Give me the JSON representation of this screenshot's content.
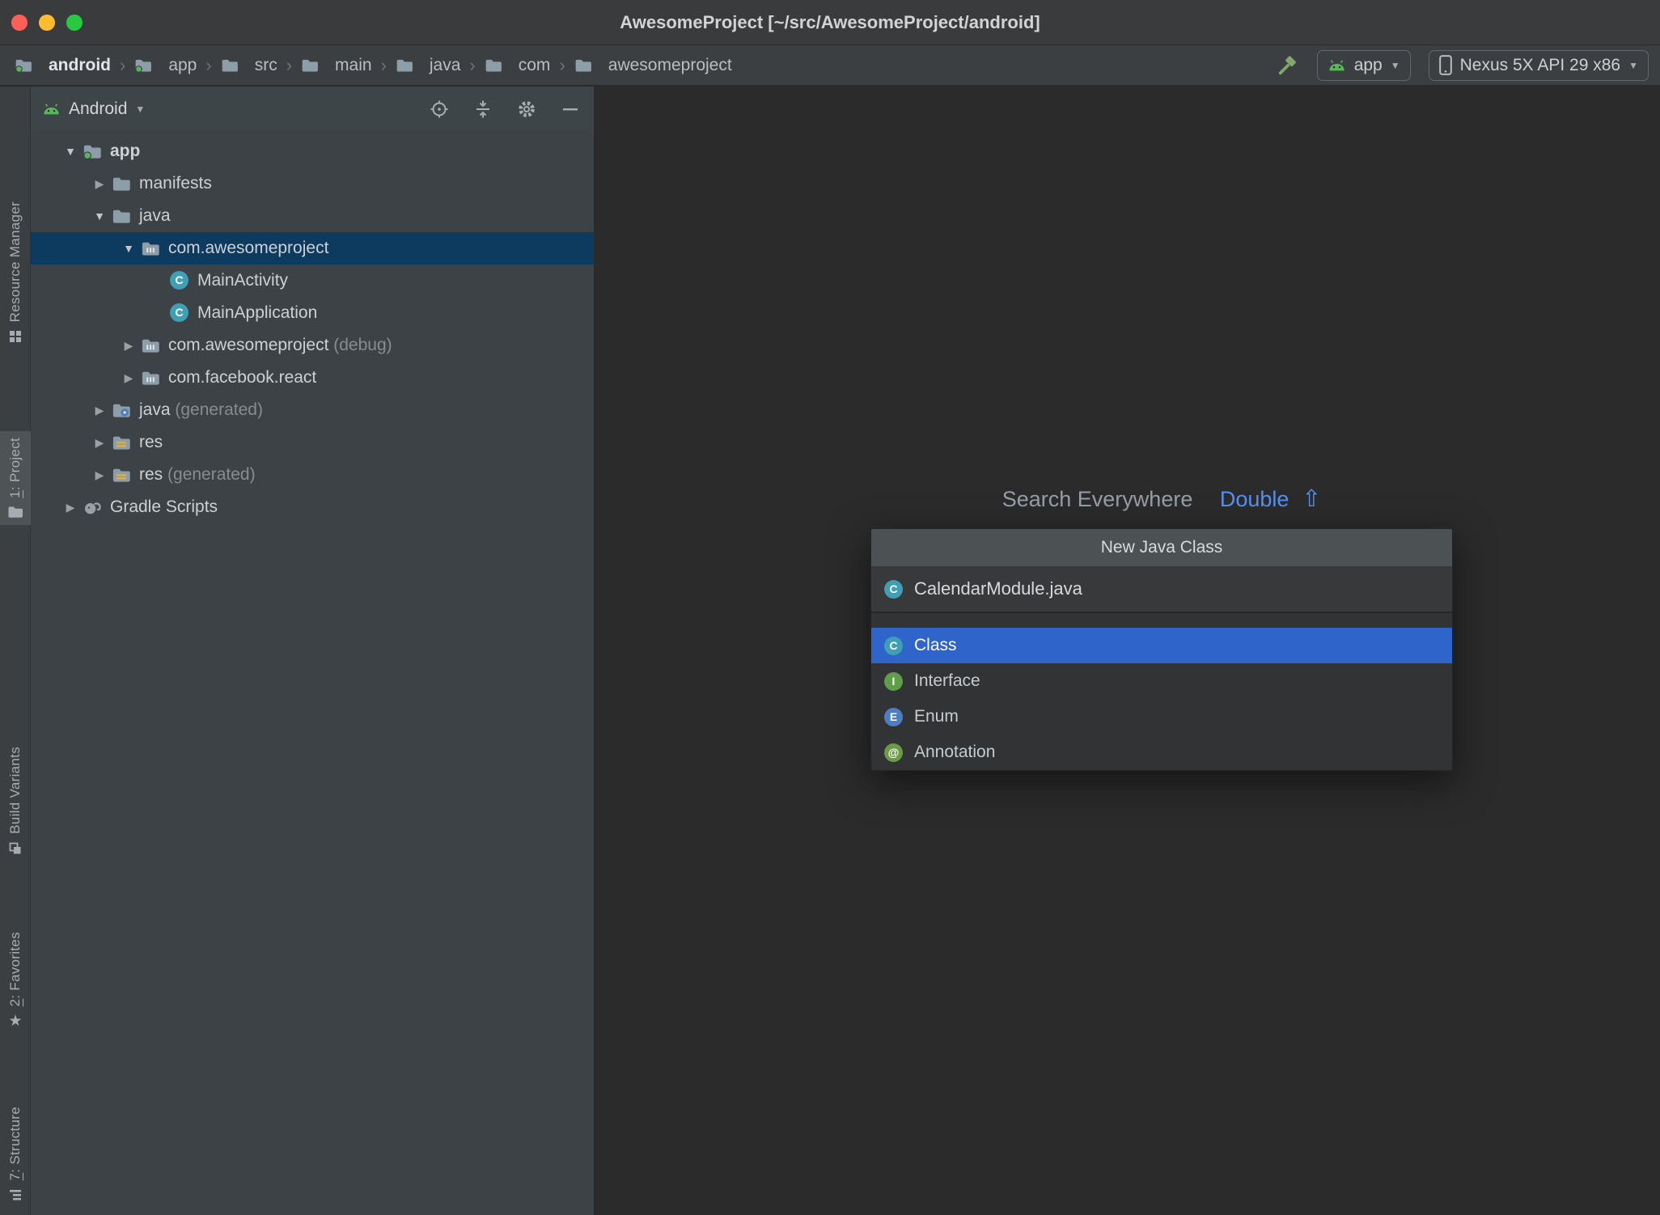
{
  "window": {
    "title": "AwesomeProject [~/src/AwesomeProject/android]"
  },
  "navbar": {
    "separator": "›",
    "breadcrumbs": [
      {
        "label": "android"
      },
      {
        "label": "app"
      },
      {
        "label": "src"
      },
      {
        "label": "main"
      },
      {
        "label": "java"
      },
      {
        "label": "com"
      },
      {
        "label": "awesomeproject"
      }
    ],
    "run_config": {
      "label": "app"
    },
    "device": {
      "label": "Nexus 5X API 29 x86"
    }
  },
  "stripe": {
    "top": [
      {
        "mnemonic": "",
        "label": "Resource Manager"
      },
      {
        "mnemonic": "1",
        "label": ": Project"
      }
    ],
    "bottom": [
      {
        "mnemonic": "",
        "label": "Build Variants"
      },
      {
        "mnemonic": "2",
        "label": ": Favorites"
      },
      {
        "mnemonic": "7",
        "label": ": Structure"
      }
    ]
  },
  "project_panel": {
    "view_selector": "Android",
    "tree": [
      {
        "label": "app"
      },
      {
        "label": "manifests"
      },
      {
        "label": "java"
      },
      {
        "label": "com.awesomeproject"
      },
      {
        "label": "MainActivity"
      },
      {
        "label": "MainApplication"
      },
      {
        "label": "com.awesomeproject",
        "suffix": " (debug)"
      },
      {
        "label": "com.facebook.react"
      },
      {
        "label": "java",
        "suffix": " (generated)"
      },
      {
        "label": "res"
      },
      {
        "label": "res",
        "suffix": " (generated)"
      },
      {
        "label": "Gradle Scripts"
      }
    ]
  },
  "editor": {
    "hint_text": "Search Everywhere",
    "hint_shortcut": "Double",
    "hint_key": "⇧"
  },
  "popup": {
    "title": "New Java Class",
    "file_name": "CalendarModule.java",
    "file_kind": "C",
    "items": [
      {
        "label": "Class",
        "kind": "C",
        "selected": true
      },
      {
        "label": "Interface",
        "kind": "I"
      },
      {
        "label": "Enum",
        "kind": "E"
      },
      {
        "label": "Annotation",
        "kind": "@"
      }
    ]
  },
  "icons": {
    "expanded": "▼",
    "collapsed": "▶",
    "dropdown": "▼",
    "favorites_star": "★",
    "class_letter": "C"
  },
  "colors": {
    "popup_selection": "#2f65ca",
    "tree_selection": "#0d3a5f",
    "class_icon": "#3f9fb4",
    "interface_icon": "#5f9e49",
    "enum_icon": "#4d7ec4",
    "annotation_icon": "#6a9c47",
    "android_green": "#57b657",
    "hint_link_blue": "#5590f2",
    "traffic_red": "#ff5f57",
    "traffic_yellow": "#febc2e",
    "traffic_green": "#28c840"
  }
}
